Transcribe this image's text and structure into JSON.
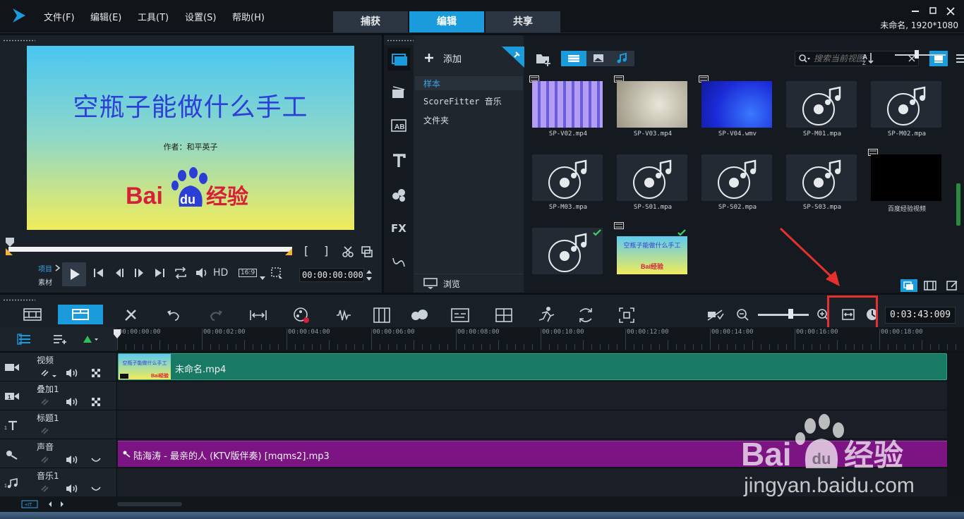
{
  "menu": [
    "文件(F)",
    "编辑(E)",
    "工具(T)",
    "设置(S)",
    "帮助(H)"
  ],
  "modes": [
    "捕获",
    "编辑",
    "共享"
  ],
  "active_mode": "编辑",
  "project_info": "未命名, 1920*1080",
  "preview": {
    "title": "空瓶子能做什么手工",
    "author": "作者：和平英子",
    "logo": "Baidu经验"
  },
  "player": {
    "mode_project": "项目",
    "mode_clip": "素材",
    "hd": "HD",
    "ratio": "16:9",
    "timecode": "00:00:00:000"
  },
  "library": {
    "add_label": "添加",
    "browse_label": "浏览",
    "folders": [
      "样本",
      "ScoreFitter 音乐",
      "文件夹"
    ],
    "search_placeholder": "搜索当前视图",
    "items": [
      {
        "name": "SP-V02.mp4",
        "kind": "video"
      },
      {
        "name": "SP-V03.mp4",
        "kind": "video"
      },
      {
        "name": "SP-V04.wmv",
        "kind": "video"
      },
      {
        "name": "SP-M01.mpa",
        "kind": "audio"
      },
      {
        "name": "SP-M02.mpa",
        "kind": "audio"
      },
      {
        "name": "SP-M03.mpa",
        "kind": "audio"
      },
      {
        "name": "SP-S01.mpa",
        "kind": "audio"
      },
      {
        "name": "SP-S02.mpa",
        "kind": "audio"
      },
      {
        "name": "SP-S03.mpa",
        "kind": "audio"
      },
      {
        "name": "百度经验视频",
        "kind": "video"
      },
      {
        "name": "",
        "kind": "audio"
      },
      {
        "name": "",
        "kind": "video-title"
      }
    ]
  },
  "timeline": {
    "duration": "0:03:43:009",
    "ruler": [
      "00:00:00:00",
      "00:00:02:00",
      "00:00:04:00",
      "00:00:06:00",
      "00:00:08:00",
      "00:00:10:00",
      "00:00:12:00",
      "00:00:14:00",
      "00:00:16:00",
      "00:00:18:00"
    ],
    "tracks": [
      {
        "name": "视频",
        "clip": "未命名.mp4"
      },
      {
        "name": "叠加1",
        "clip": ""
      },
      {
        "name": "标题1",
        "clip": ""
      },
      {
        "name": "声音",
        "clip": "陆海涛 - 最亲的人 (KTV版伴奏) [mqms2].mp3"
      },
      {
        "name": "音乐1",
        "clip": ""
      }
    ]
  },
  "watermark": {
    "logo": "Baidu经验",
    "url": "jingyan.baidu.com"
  },
  "colors": {
    "accent": "#1a9bdc",
    "video_clip": "#187a64",
    "audio_clip": "#7d1484",
    "highlight": "#e63030"
  }
}
